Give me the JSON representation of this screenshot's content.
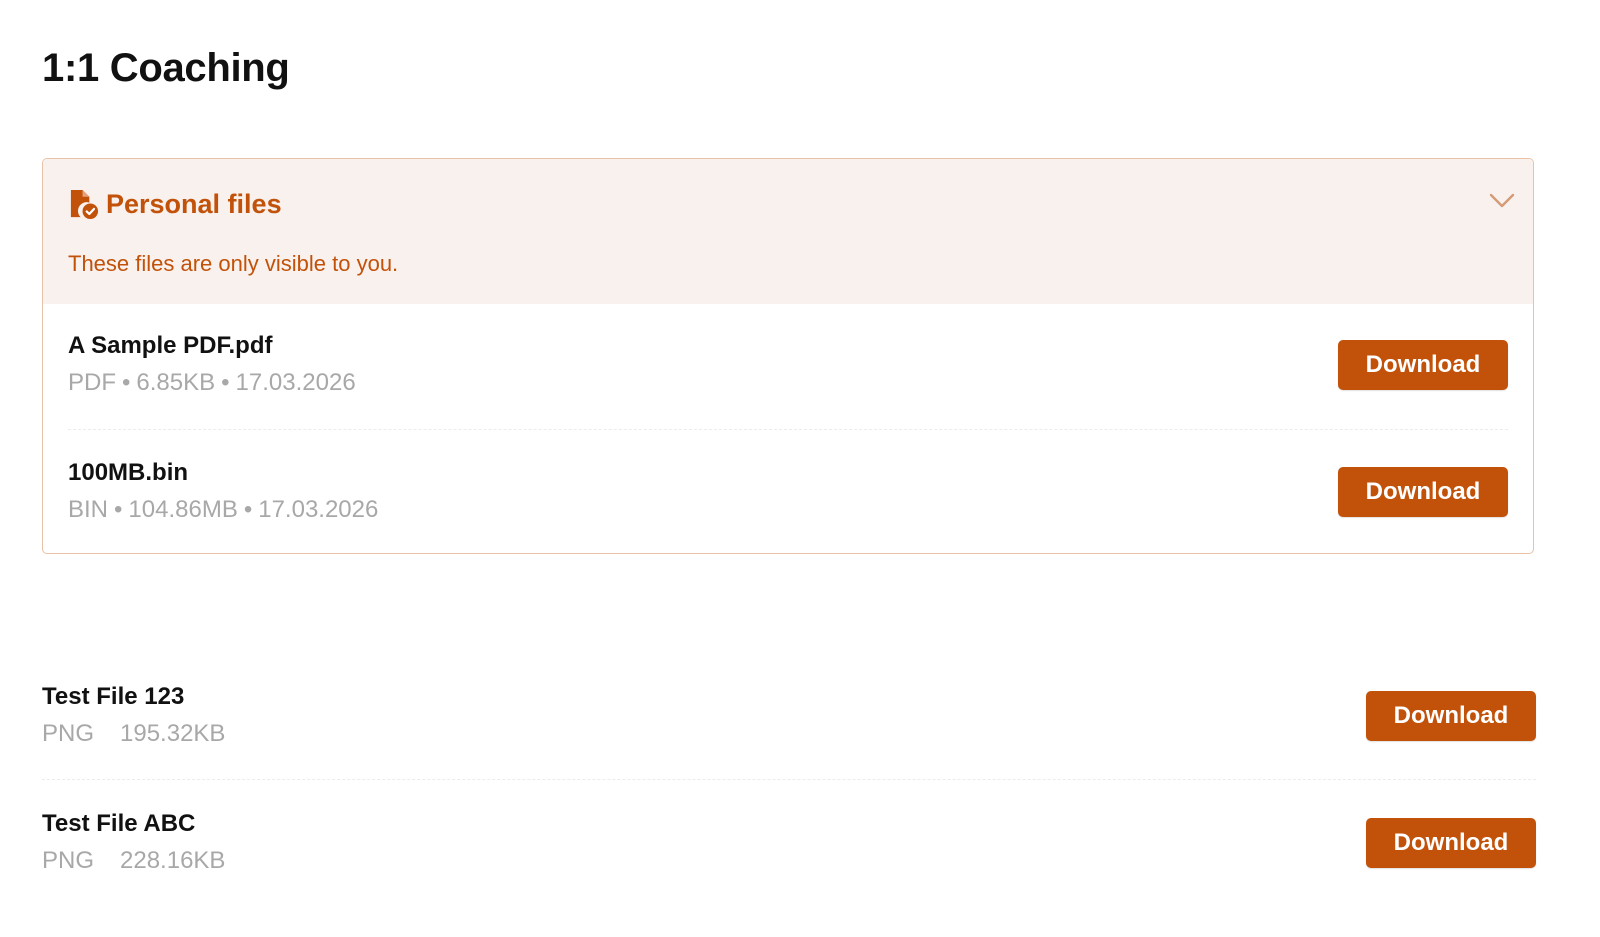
{
  "page": {
    "title": "1:1 Coaching"
  },
  "personal_files": {
    "title": "Personal files",
    "description": "These files are only visible to you.",
    "icon": "file-check-icon",
    "toggle_icon": "chevron-down-icon",
    "files": [
      {
        "name": "A Sample PDF.pdf",
        "type": "PDF",
        "size": "6.85KB",
        "date": "17.03.2026",
        "button": "Download"
      },
      {
        "name": "100MB.bin",
        "type": "BIN",
        "size": "104.86MB",
        "date": "17.03.2026",
        "button": "Download"
      }
    ]
  },
  "shared_files": [
    {
      "name": "Test File 123",
      "type": "PNG",
      "size": "195.32KB",
      "button": "Download"
    },
    {
      "name": "Test File ABC",
      "type": "PNG",
      "size": "228.16KB",
      "button": "Download"
    }
  ],
  "colors": {
    "accent": "#c2520a",
    "panel_background": "#f8f1ed",
    "panel_border": "#e9c1a6",
    "meta_text": "#a8a8a8"
  },
  "separator": "•"
}
